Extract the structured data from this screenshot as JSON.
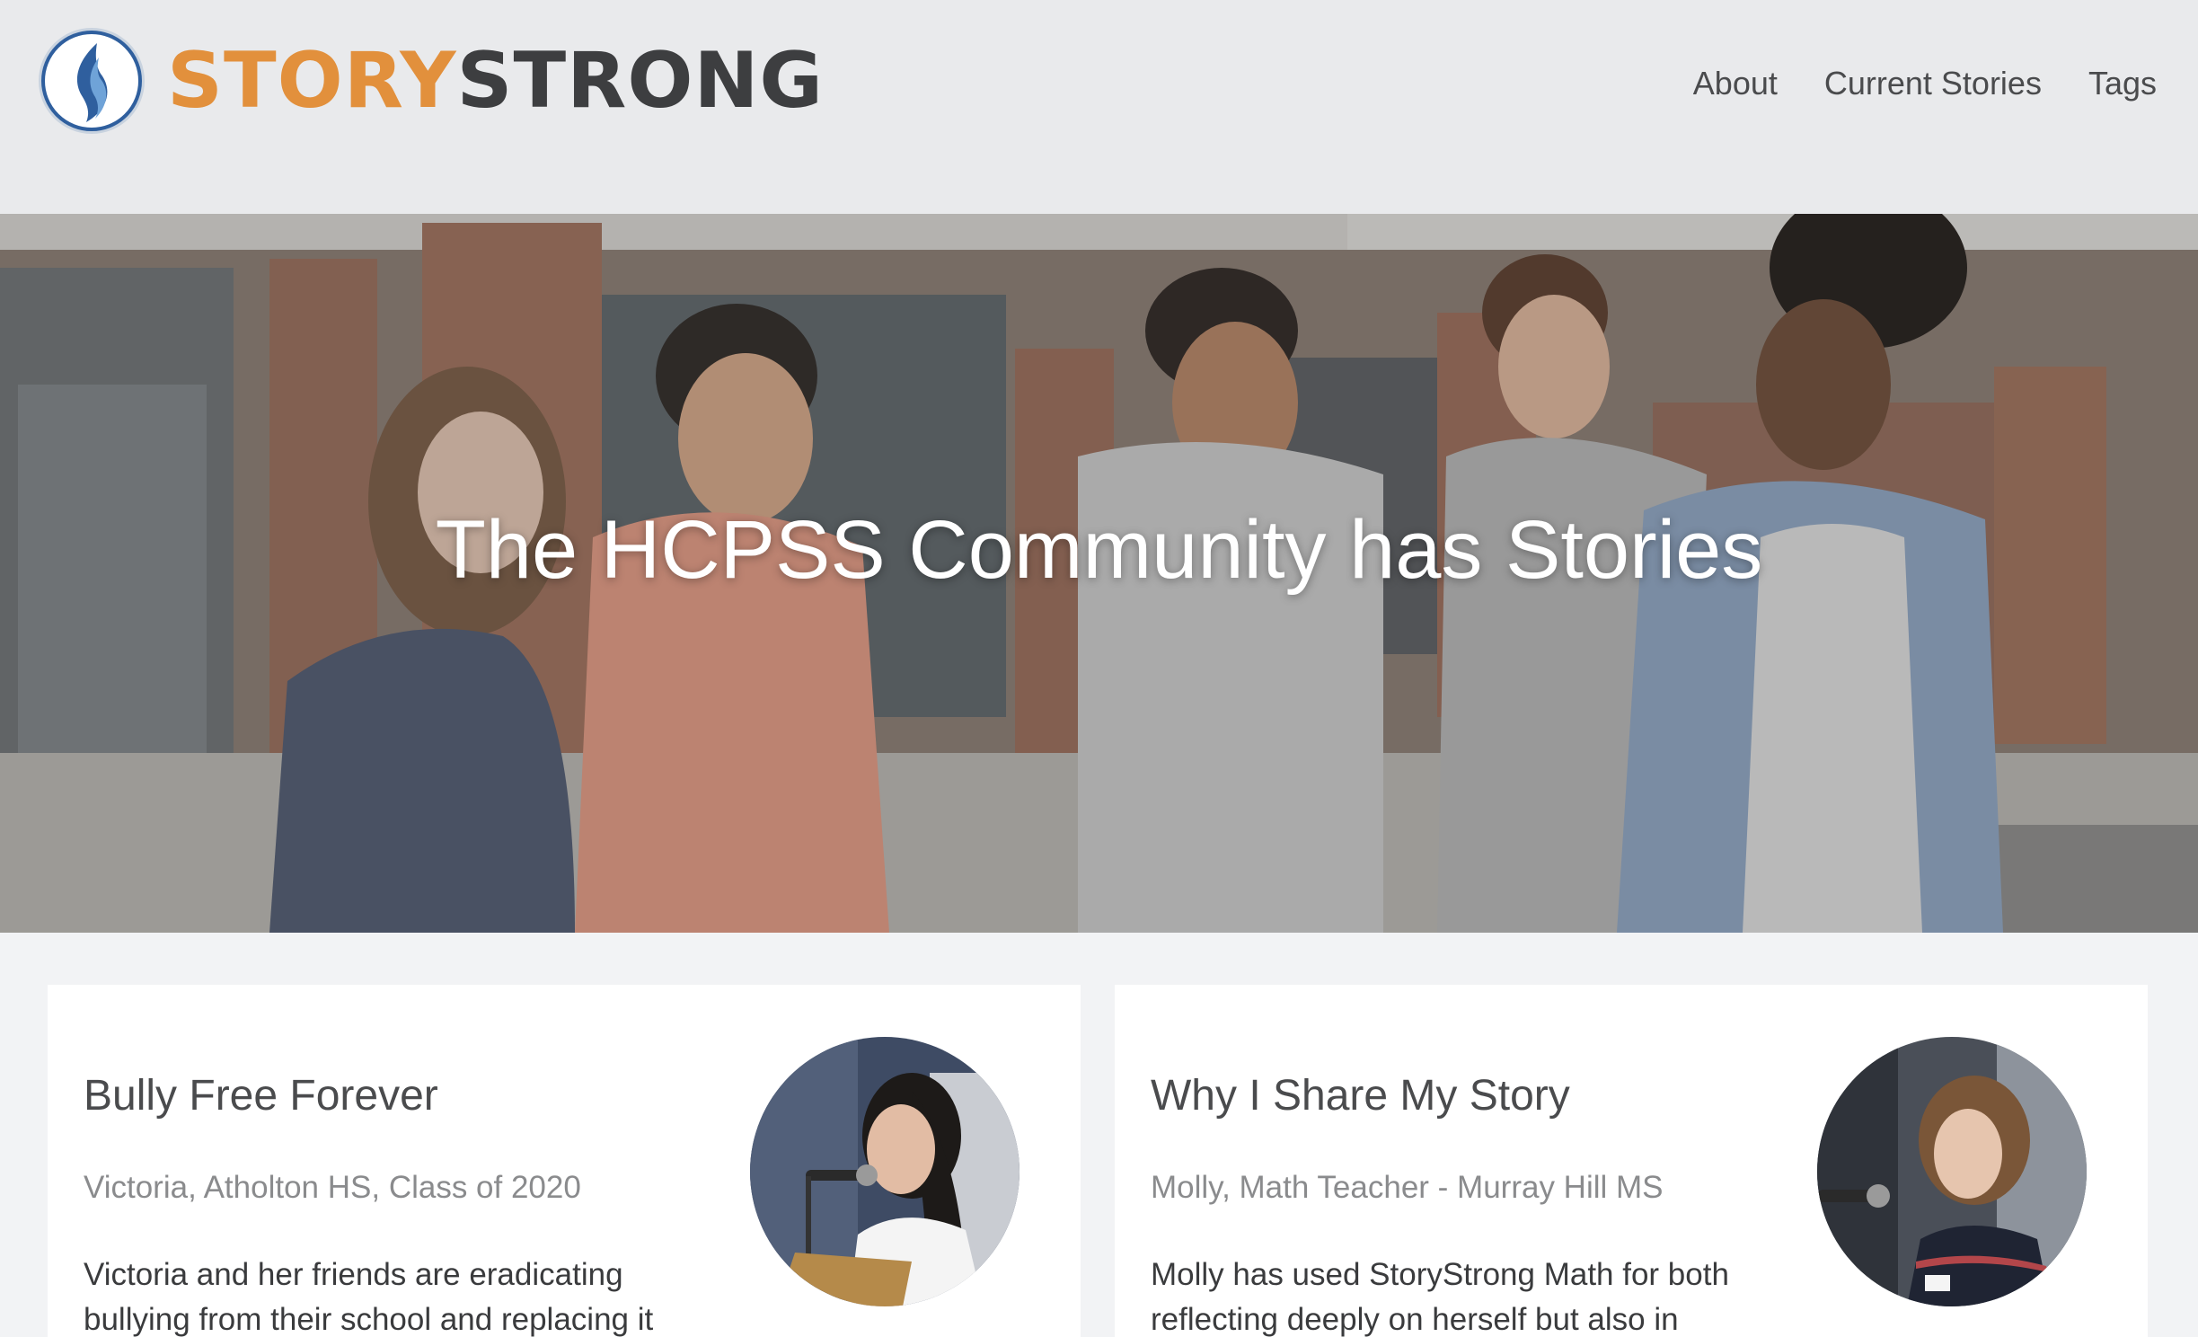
{
  "brand": {
    "word1": "STORY",
    "word2": "STRONG",
    "icon": "flame-logo-icon"
  },
  "nav": {
    "items": [
      {
        "label": "About"
      },
      {
        "label": "Current Stories"
      },
      {
        "label": "Tags"
      }
    ]
  },
  "hero": {
    "title": "The HCPSS Community has Stories"
  },
  "stories": [
    {
      "title": "Bully Free Forever",
      "subtitle": "Victoria, Atholton HS, Class of 2020",
      "excerpt": "Victoria and her friends are eradicating bullying from their school and replacing it"
    },
    {
      "title": "Why I Share My Story",
      "subtitle": "Molly, Math Teacher - Murray Hill MS",
      "excerpt": "Molly has used StoryStrong Math for both reflecting deeply on herself but also in"
    }
  ],
  "colors": {
    "accent": "#e2903c",
    "logo_dark": "#3d3e40",
    "header_bg": "#e9eaec",
    "page_bg": "#f2f3f5"
  }
}
